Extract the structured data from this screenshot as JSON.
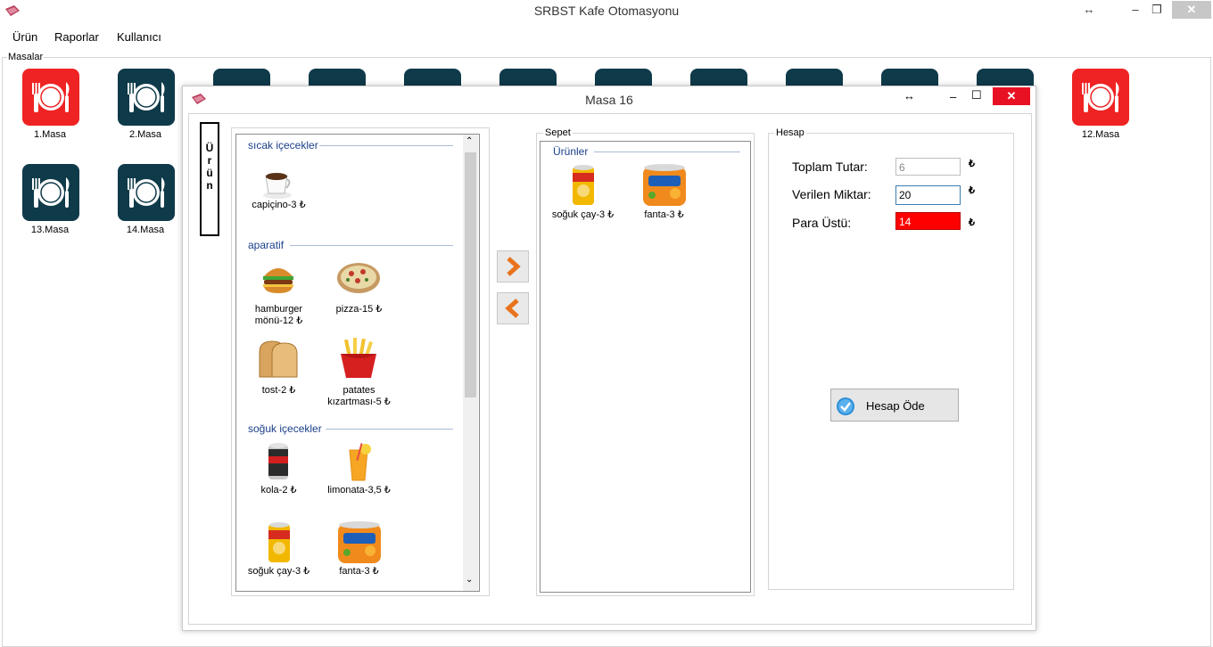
{
  "window": {
    "title": "SRBST Kafe Otomasyonu",
    "controls": {
      "resize": "↔",
      "minimize": "–",
      "restore": "❐",
      "close": "✕"
    }
  },
  "menu": [
    "Ürün",
    "Raporlar",
    "Kullanıcı"
  ],
  "masalar_label": "Masalar",
  "tables": [
    {
      "label": "1.Masa",
      "status": "occupied"
    },
    {
      "label": "2.Masa",
      "status": "empty"
    },
    {
      "label": "12.Masa",
      "status": "occupied"
    },
    {
      "label": "13.Masa",
      "status": "empty"
    },
    {
      "label": "14.Masa",
      "status": "empty"
    }
  ],
  "colors": {
    "occupied": "#ef2323",
    "empty": "#0f3a4a",
    "para_ustu_bg": "#ff0000",
    "accent_link": "#1a3f8a"
  },
  "dialog": {
    "title": "Masa 16",
    "controls": {
      "resize": "↔",
      "minimize": "–",
      "maximize": "☐",
      "close": "✕"
    },
    "urun_button": "Ü\nr\nü\nn",
    "categories": [
      {
        "name": "sıcak içecekler",
        "items": [
          {
            "label": "capiçino-3 ₺",
            "icon": "coffee-cup-icon"
          }
        ]
      },
      {
        "name": "aparatif",
        "items": [
          {
            "label": "hamburger mönü-12 ₺",
            "icon": "hamburger-icon"
          },
          {
            "label": "pizza-15 ₺",
            "icon": "pizza-icon"
          },
          {
            "label": "tost-2 ₺",
            "icon": "toast-icon"
          },
          {
            "label": "patates kızartması-5 ₺",
            "icon": "fries-icon"
          }
        ]
      },
      {
        "name": "soğuk içecekler",
        "items": [
          {
            "label": "kola-2 ₺",
            "icon": "cola-can-icon"
          },
          {
            "label": "limonata-3,5 ₺",
            "icon": "lemonade-icon"
          },
          {
            "label": "soğuk çay-3 ₺",
            "icon": "iced-tea-can-icon"
          },
          {
            "label": "fanta-3 ₺",
            "icon": "fanta-can-icon"
          }
        ]
      }
    ],
    "sepet": {
      "legend": "Sepet",
      "header": "Ürünler",
      "items": [
        {
          "label": "soğuk çay-3 ₺",
          "icon": "iced-tea-can-icon"
        },
        {
          "label": "fanta-3 ₺",
          "icon": "fanta-can-icon"
        }
      ]
    },
    "hesap": {
      "legend": "Hesap",
      "toplam_label": "Toplam Tutar:",
      "toplam_value": "6",
      "verilen_label": "Verilen Miktar:",
      "verilen_value": "20",
      "para_ustu_label": "Para Üstü:",
      "para_ustu_value": "14",
      "currency": "₺",
      "pay_button": "Hesap Öde"
    }
  }
}
